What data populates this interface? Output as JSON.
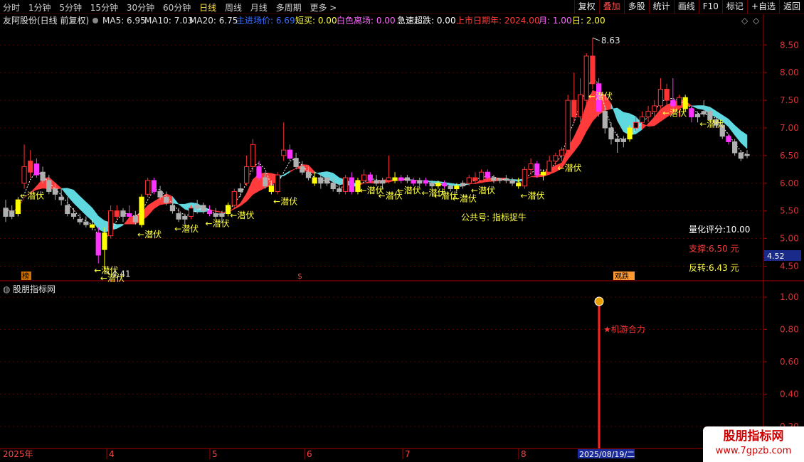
{
  "toolbar": {
    "periods": [
      "分时",
      "1分钟",
      "5分钟",
      "15分钟",
      "30分钟",
      "60分钟",
      "日线",
      "周线",
      "月线",
      "多周期",
      "更多 >"
    ],
    "active_period": "日线",
    "right_buttons": [
      "复权",
      "叠加",
      "多股",
      "统计",
      "画线",
      "F10",
      "标记",
      "+自选",
      "返回"
    ],
    "accent_button": "叠加"
  },
  "header": {
    "stock": "友阿股份(日线 前复权)",
    "ma5": "MA5: 6.95",
    "ma10": "MA10: 7.03",
    "ma20": "MA20: 6.75",
    "indicator_label": "主进场价: 6.69",
    "short_buy": "短买: 0.00",
    "white_zone": "白色离场: 0.00",
    "rapid_drop": "急速超跌: 0.00",
    "listing_year": "上市日期年: 2024.00",
    "month": "月: 1.00",
    "day": "日: 2.00"
  },
  "main_chart": {
    "y_ticks": [
      "8.50",
      "8.00",
      "7.50",
      "7.00",
      "6.50",
      "6.00",
      "5.50",
      "5.00",
      "4.50"
    ],
    "ylim": [
      4.3,
      8.8
    ],
    "high_label": "8.63",
    "low_label": "4.41",
    "price_tag": "4.52",
    "annotation_text": "←潜伏",
    "annotation_short": "潜伏",
    "watermark_text": "公共号: 指标捉牛",
    "score": "量化评分:10.00",
    "support": "支撑:6.50 元",
    "reversal": "反转:6.43 元",
    "bottom_markers": [
      "榜",
      "$",
      "观跌"
    ]
  },
  "sub_chart": {
    "title": "股朋指标网",
    "y_ticks": [
      "1.00",
      "0.80",
      "0.60",
      "0.40",
      "0.20"
    ],
    "signal_label": "★机游合力",
    "signal_value": 1.0
  },
  "x_axis": {
    "labels": [
      "2025年",
      "4",
      "5",
      "6",
      "7",
      "8"
    ],
    "selected_date": "2025/08/19/二"
  },
  "brand": {
    "name": "股朋指标网",
    "url": "www.7gpzb.com"
  },
  "colors": {
    "up": "#ff3333",
    "down": "#50e0e0",
    "yellow": "#ffff00",
    "magenta": "#ff33ff",
    "gray": "#b0b0b0",
    "ribbon_red": "#ff3b3b",
    "ribbon_cyan": "#5fd8e0",
    "axis_red": "#aa0000"
  },
  "chart_data": {
    "type": "candlestick",
    "ylim": [
      4.3,
      8.8
    ],
    "candles": [
      {
        "o": 5.4,
        "h": 5.7,
        "l": 5.3,
        "c": 5.55,
        "k": "gray"
      },
      {
        "o": 5.5,
        "h": 5.6,
        "l": 5.35,
        "c": 5.4,
        "k": "gray"
      },
      {
        "o": 5.45,
        "h": 5.75,
        "l": 5.4,
        "c": 5.7,
        "k": "yellow"
      },
      {
        "o": 6.0,
        "h": 6.7,
        "l": 5.9,
        "c": 6.3,
        "k": "up"
      },
      {
        "o": 6.4,
        "h": 6.6,
        "l": 6.1,
        "c": 6.2,
        "k": "up"
      },
      {
        "o": 6.35,
        "h": 6.45,
        "l": 6.1,
        "c": 6.15,
        "k": "magenta"
      },
      {
        "o": 6.2,
        "h": 6.3,
        "l": 6.0,
        "c": 6.05,
        "k": "gray"
      },
      {
        "o": 6.05,
        "h": 6.15,
        "l": 5.8,
        "c": 5.85,
        "k": "gray"
      },
      {
        "o": 5.9,
        "h": 6.0,
        "l": 5.7,
        "c": 5.8,
        "k": "gray"
      },
      {
        "o": 5.75,
        "h": 5.9,
        "l": 5.6,
        "c": 5.7,
        "k": "gray"
      },
      {
        "o": 5.6,
        "h": 5.75,
        "l": 5.4,
        "c": 5.45,
        "k": "gray"
      },
      {
        "o": 5.45,
        "h": 5.55,
        "l": 5.35,
        "c": 5.4,
        "k": "gray"
      },
      {
        "o": 5.35,
        "h": 5.45,
        "l": 5.25,
        "c": 5.3,
        "k": "gray"
      },
      {
        "o": 5.3,
        "h": 5.4,
        "l": 5.2,
        "c": 5.25,
        "k": "gray"
      },
      {
        "o": 5.25,
        "h": 5.35,
        "l": 5.15,
        "c": 5.2,
        "k": "yellow"
      },
      {
        "o": 5.1,
        "h": 5.2,
        "l": 4.55,
        "c": 4.7,
        "k": "magenta"
      },
      {
        "o": 4.8,
        "h": 5.2,
        "l": 4.41,
        "c": 5.1,
        "k": "yellow"
      },
      {
        "o": 5.05,
        "h": 5.6,
        "l": 5.0,
        "c": 5.5,
        "k": "up"
      },
      {
        "o": 5.5,
        "h": 5.6,
        "l": 5.35,
        "c": 5.4,
        "k": "up"
      },
      {
        "o": 5.4,
        "h": 5.55,
        "l": 5.3,
        "c": 5.5,
        "k": "gray"
      },
      {
        "o": 5.45,
        "h": 5.6,
        "l": 5.35,
        "c": 5.4,
        "k": "magenta"
      },
      {
        "o": 5.4,
        "h": 5.5,
        "l": 5.25,
        "c": 5.3,
        "k": "gray"
      },
      {
        "o": 5.25,
        "h": 5.8,
        "l": 5.2,
        "c": 5.75,
        "k": "yellow"
      },
      {
        "o": 5.8,
        "h": 6.1,
        "l": 5.75,
        "c": 6.05,
        "k": "up"
      },
      {
        "o": 6.05,
        "h": 6.1,
        "l": 5.8,
        "c": 5.85,
        "k": "magenta"
      },
      {
        "o": 5.85,
        "h": 5.95,
        "l": 5.7,
        "c": 5.75,
        "k": "gray"
      },
      {
        "o": 5.75,
        "h": 5.85,
        "l": 5.6,
        "c": 5.65,
        "k": "gray"
      },
      {
        "o": 5.6,
        "h": 5.7,
        "l": 5.45,
        "c": 5.5,
        "k": "gray"
      },
      {
        "o": 5.45,
        "h": 5.55,
        "l": 5.3,
        "c": 5.35,
        "k": "gray"
      },
      {
        "o": 5.35,
        "h": 5.45,
        "l": 5.25,
        "c": 5.4,
        "k": "gray"
      },
      {
        "o": 5.4,
        "h": 5.6,
        "l": 5.35,
        "c": 5.55,
        "k": "up"
      },
      {
        "o": 5.55,
        "h": 5.7,
        "l": 5.45,
        "c": 5.6,
        "k": "gray"
      },
      {
        "o": 5.6,
        "h": 5.65,
        "l": 5.45,
        "c": 5.5,
        "k": "gray"
      },
      {
        "o": 5.5,
        "h": 5.6,
        "l": 5.4,
        "c": 5.45,
        "k": "magenta"
      },
      {
        "o": 5.45,
        "h": 5.55,
        "l": 5.35,
        "c": 5.4,
        "k": "gray"
      },
      {
        "o": 5.4,
        "h": 5.5,
        "l": 5.3,
        "c": 5.45,
        "k": "gray"
      },
      {
        "o": 5.45,
        "h": 5.65,
        "l": 5.4,
        "c": 5.6,
        "k": "yellow"
      },
      {
        "o": 5.6,
        "h": 5.9,
        "l": 5.55,
        "c": 5.85,
        "k": "up"
      },
      {
        "o": 5.85,
        "h": 6.0,
        "l": 5.75,
        "c": 5.9,
        "k": "gray"
      },
      {
        "o": 6.0,
        "h": 6.5,
        "l": 5.95,
        "c": 6.3,
        "k": "up"
      },
      {
        "o": 6.3,
        "h": 6.8,
        "l": 6.2,
        "c": 6.7,
        "k": "up"
      },
      {
        "o": 6.3,
        "h": 6.4,
        "l": 6.05,
        "c": 6.1,
        "k": "magenta"
      },
      {
        "o": 6.1,
        "h": 6.2,
        "l": 5.9,
        "c": 5.95,
        "k": "gray"
      },
      {
        "o": 5.95,
        "h": 6.05,
        "l": 5.8,
        "c": 5.85,
        "k": "yellow"
      },
      {
        "o": 5.85,
        "h": 6.2,
        "l": 5.8,
        "c": 6.15,
        "k": "up"
      },
      {
        "o": 6.5,
        "h": 7.1,
        "l": 6.4,
        "c": 6.6,
        "k": "up"
      },
      {
        "o": 6.6,
        "h": 6.7,
        "l": 6.4,
        "c": 6.45,
        "k": "magenta"
      },
      {
        "o": 6.45,
        "h": 6.55,
        "l": 6.25,
        "c": 6.3,
        "k": "gray"
      },
      {
        "o": 6.3,
        "h": 6.4,
        "l": 6.15,
        "c": 6.2,
        "k": "gray"
      },
      {
        "o": 6.2,
        "h": 6.3,
        "l": 6.05,
        "c": 6.1,
        "k": "gray"
      },
      {
        "o": 6.1,
        "h": 6.2,
        "l": 5.95,
        "c": 6.0,
        "k": "yellow"
      },
      {
        "o": 6.0,
        "h": 6.15,
        "l": 5.9,
        "c": 6.1,
        "k": "gray"
      },
      {
        "o": 6.1,
        "h": 6.2,
        "l": 5.95,
        "c": 6.0,
        "k": "gray"
      },
      {
        "o": 6.0,
        "h": 6.1,
        "l": 5.85,
        "c": 5.9,
        "k": "gray"
      },
      {
        "o": 5.9,
        "h": 6.0,
        "l": 5.8,
        "c": 5.85,
        "k": "gray"
      },
      {
        "o": 5.85,
        "h": 6.15,
        "l": 5.8,
        "c": 6.1,
        "k": "up"
      },
      {
        "o": 6.1,
        "h": 6.2,
        "l": 5.8,
        "c": 5.85,
        "k": "magenta"
      },
      {
        "o": 5.85,
        "h": 6.1,
        "l": 5.8,
        "c": 6.05,
        "k": "yellow"
      },
      {
        "o": 6.05,
        "h": 6.25,
        "l": 6.0,
        "c": 6.15,
        "k": "up"
      },
      {
        "o": 6.15,
        "h": 6.2,
        "l": 6.0,
        "c": 6.05,
        "k": "magenta"
      },
      {
        "o": 6.05,
        "h": 6.15,
        "l": 5.95,
        "c": 6.0,
        "k": "gray"
      },
      {
        "o": 6.0,
        "h": 6.1,
        "l": 5.9,
        "c": 6.05,
        "k": "gray"
      },
      {
        "o": 6.05,
        "h": 6.5,
        "l": 6.0,
        "c": 6.1,
        "k": "up"
      },
      {
        "o": 6.1,
        "h": 6.2,
        "l": 6.0,
        "c": 6.05,
        "k": "yellow"
      },
      {
        "o": 6.05,
        "h": 6.15,
        "l": 6.0,
        "c": 6.1,
        "k": "magenta"
      },
      {
        "o": 6.1,
        "h": 6.15,
        "l": 6.0,
        "c": 6.05,
        "k": "gray"
      },
      {
        "o": 6.05,
        "h": 6.1,
        "l": 5.95,
        "c": 6.0,
        "k": "magenta"
      },
      {
        "o": 6.0,
        "h": 6.1,
        "l": 5.95,
        "c": 6.05,
        "k": "gray"
      },
      {
        "o": 6.05,
        "h": 6.1,
        "l": 5.95,
        "c": 6.0,
        "k": "magenta"
      },
      {
        "o": 6.0,
        "h": 6.05,
        "l": 5.9,
        "c": 5.95,
        "k": "gray"
      },
      {
        "o": 5.95,
        "h": 6.05,
        "l": 5.9,
        "c": 6.0,
        "k": "yellow"
      },
      {
        "o": 6.0,
        "h": 6.05,
        "l": 5.9,
        "c": 5.95,
        "k": "magenta"
      },
      {
        "o": 5.95,
        "h": 6.0,
        "l": 5.85,
        "c": 5.9,
        "k": "gray"
      },
      {
        "o": 5.9,
        "h": 6.0,
        "l": 5.85,
        "c": 5.95,
        "k": "yellow"
      },
      {
        "o": 5.95,
        "h": 6.05,
        "l": 5.9,
        "c": 6.0,
        "k": "gray"
      },
      {
        "o": 6.0,
        "h": 6.15,
        "l": 5.95,
        "c": 6.1,
        "k": "up"
      },
      {
        "o": 6.1,
        "h": 6.2,
        "l": 6.0,
        "c": 6.05,
        "k": "up"
      },
      {
        "o": 6.05,
        "h": 6.25,
        "l": 6.0,
        "c": 6.2,
        "k": "up"
      },
      {
        "o": 6.2,
        "h": 6.25,
        "l": 6.05,
        "c": 6.1,
        "k": "magenta"
      },
      {
        "o": 6.1,
        "h": 6.15,
        "l": 6.0,
        "c": 6.05,
        "k": "gray"
      },
      {
        "o": 6.05,
        "h": 6.1,
        "l": 6.0,
        "c": 6.08,
        "k": "gray"
      },
      {
        "o": 6.08,
        "h": 6.15,
        "l": 6.0,
        "c": 6.05,
        "k": "gray"
      },
      {
        "o": 6.05,
        "h": 6.1,
        "l": 5.95,
        "c": 6.0,
        "k": "gray"
      },
      {
        "o": 6.0,
        "h": 6.1,
        "l": 5.9,
        "c": 5.95,
        "k": "yellow"
      },
      {
        "o": 5.95,
        "h": 6.3,
        "l": 5.9,
        "c": 6.25,
        "k": "up"
      },
      {
        "o": 6.25,
        "h": 6.45,
        "l": 6.15,
        "c": 6.35,
        "k": "up"
      },
      {
        "o": 6.35,
        "h": 6.4,
        "l": 6.1,
        "c": 6.15,
        "k": "magenta"
      },
      {
        "o": 6.15,
        "h": 6.25,
        "l": 6.05,
        "c": 6.2,
        "k": "yellow"
      },
      {
        "o": 6.2,
        "h": 6.5,
        "l": 6.15,
        "c": 6.4,
        "k": "up"
      },
      {
        "o": 6.4,
        "h": 6.55,
        "l": 6.3,
        "c": 6.5,
        "k": "up"
      },
      {
        "o": 6.5,
        "h": 6.65,
        "l": 6.4,
        "c": 6.6,
        "k": "up"
      },
      {
        "o": 6.6,
        "h": 7.6,
        "l": 6.55,
        "c": 7.5,
        "k": "up"
      },
      {
        "o": 7.5,
        "h": 8.0,
        "l": 7.1,
        "c": 7.2,
        "k": "up"
      },
      {
        "o": 7.2,
        "h": 7.9,
        "l": 7.1,
        "c": 7.6,
        "k": "up"
      },
      {
        "o": 7.5,
        "h": 8.35,
        "l": 7.45,
        "c": 8.3,
        "k": "up"
      },
      {
        "o": 8.3,
        "h": 8.63,
        "l": 7.7,
        "c": 7.8,
        "k": "up"
      },
      {
        "o": 7.8,
        "h": 7.9,
        "l": 7.2,
        "c": 7.3,
        "k": "magenta"
      },
      {
        "o": 7.3,
        "h": 7.4,
        "l": 6.9,
        "c": 7.0,
        "k": "gray"
      },
      {
        "o": 7.0,
        "h": 7.1,
        "l": 6.7,
        "c": 6.8,
        "k": "gray"
      },
      {
        "o": 6.8,
        "h": 6.9,
        "l": 6.55,
        "c": 6.75,
        "k": "gray"
      },
      {
        "o": 6.75,
        "h": 6.85,
        "l": 6.65,
        "c": 6.8,
        "k": "gray"
      },
      {
        "o": 6.8,
        "h": 7.05,
        "l": 6.75,
        "c": 7.0,
        "k": "yellow"
      },
      {
        "o": 7.0,
        "h": 7.2,
        "l": 6.95,
        "c": 7.1,
        "k": "up"
      },
      {
        "o": 7.1,
        "h": 7.3,
        "l": 7.0,
        "c": 7.2,
        "k": "up"
      },
      {
        "o": 7.2,
        "h": 7.4,
        "l": 7.1,
        "c": 7.3,
        "k": "up"
      },
      {
        "o": 7.3,
        "h": 7.5,
        "l": 7.2,
        "c": 7.4,
        "k": "up"
      },
      {
        "o": 7.4,
        "h": 7.9,
        "l": 7.35,
        "c": 7.7,
        "k": "up"
      },
      {
        "o": 7.7,
        "h": 7.8,
        "l": 7.4,
        "c": 7.5,
        "k": "up"
      },
      {
        "o": 7.5,
        "h": 7.9,
        "l": 7.3,
        "c": 7.4,
        "k": "magenta"
      },
      {
        "o": 7.4,
        "h": 7.6,
        "l": 7.2,
        "c": 7.55,
        "k": "up"
      },
      {
        "o": 7.55,
        "h": 7.6,
        "l": 7.3,
        "c": 7.35,
        "k": "yellow"
      },
      {
        "o": 7.35,
        "h": 7.4,
        "l": 7.1,
        "c": 7.2,
        "k": "magenta"
      },
      {
        "o": 7.2,
        "h": 7.3,
        "l": 7.1,
        "c": 7.25,
        "k": "gray"
      },
      {
        "o": 7.25,
        "h": 7.5,
        "l": 7.2,
        "c": 7.3,
        "k": "gray"
      },
      {
        "o": 7.3,
        "h": 7.35,
        "l": 7.1,
        "c": 7.15,
        "k": "gray"
      },
      {
        "o": 7.15,
        "h": 7.2,
        "l": 7.0,
        "c": 7.05,
        "k": "gray"
      },
      {
        "o": 7.05,
        "h": 7.1,
        "l": 6.8,
        "c": 6.85,
        "k": "gray"
      },
      {
        "o": 6.85,
        "h": 6.9,
        "l": 6.7,
        "c": 6.75,
        "k": "magenta"
      },
      {
        "o": 6.75,
        "h": 6.8,
        "l": 6.5,
        "c": 6.55,
        "k": "gray"
      },
      {
        "o": 6.55,
        "h": 6.6,
        "l": 6.4,
        "c": 6.45,
        "k": "gray"
      },
      {
        "o": 6.5,
        "h": 6.6,
        "l": 6.45,
        "c": 6.52,
        "k": "gray"
      }
    ]
  }
}
